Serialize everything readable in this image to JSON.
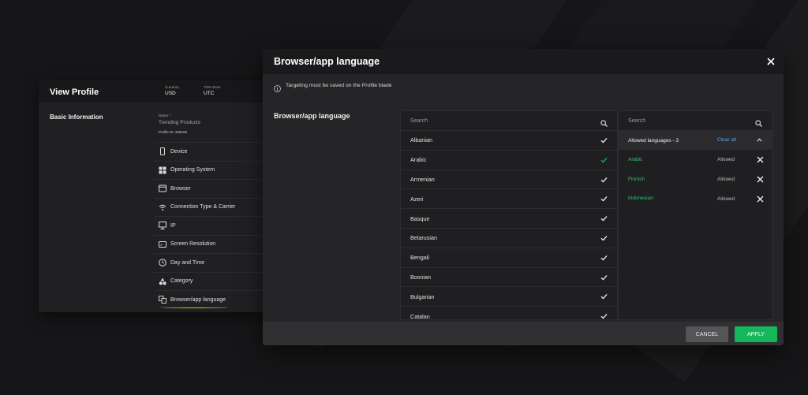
{
  "profile": {
    "title": "View Profile",
    "currency_label": "Currency",
    "currency_value": "USD",
    "timezone_label": "Time Zone",
    "timezone_value": "UTC",
    "section_title": "Basic Information",
    "name_label": "Name *",
    "name_value": "Trending Products",
    "profile_id": "Profile ID: 258165",
    "nav_items": [
      {
        "label": "Device",
        "icon": "device-icon"
      },
      {
        "label": "Operating System",
        "icon": "windows-icon"
      },
      {
        "label": "Browser",
        "icon": "browser-icon"
      },
      {
        "label": "Connection Type & Carrier",
        "icon": "wifi-icon"
      },
      {
        "label": "IP",
        "icon": "ip-icon"
      },
      {
        "label": "Screen Resolution",
        "icon": "screen-icon"
      },
      {
        "label": "Day and Time",
        "icon": "clock-icon"
      },
      {
        "label": "Category",
        "icon": "category-icon"
      },
      {
        "label": "Browser/app language",
        "icon": "language-icon"
      }
    ]
  },
  "modal": {
    "title": "Browser/app language",
    "notice": "Targeting must be saved on the Profile blade",
    "field_label": "Browser/app language",
    "search_placeholder": "Search",
    "languages": [
      {
        "name": "Albanian",
        "selected": false
      },
      {
        "name": "Arabic",
        "selected": true
      },
      {
        "name": "Armenian",
        "selected": false
      },
      {
        "name": "Azeri",
        "selected": false
      },
      {
        "name": "Basque",
        "selected": false
      },
      {
        "name": "Belarusian",
        "selected": false
      },
      {
        "name": "Bengali",
        "selected": false
      },
      {
        "name": "Bosnian",
        "selected": false
      },
      {
        "name": "Bulgarian",
        "selected": false
      },
      {
        "name": "Catalan",
        "selected": false
      }
    ],
    "allowed_search_placeholder": "Search",
    "allowed_count": "Allowed languages - 3",
    "clear_all": "Clear all",
    "allowed": [
      {
        "name": "Arabic",
        "status": "Allowed"
      },
      {
        "name": "Finnish",
        "status": "Allowed"
      },
      {
        "name": "Indonesian",
        "status": "Allowed"
      }
    ],
    "cancel_label": "CANCEL",
    "apply_label": "APPLY"
  },
  "colors": {
    "accent_green": "#14b85a",
    "allowed_text": "#29c86a",
    "link_blue": "#4da3ff",
    "highlight_underline": "#e5b92a"
  }
}
